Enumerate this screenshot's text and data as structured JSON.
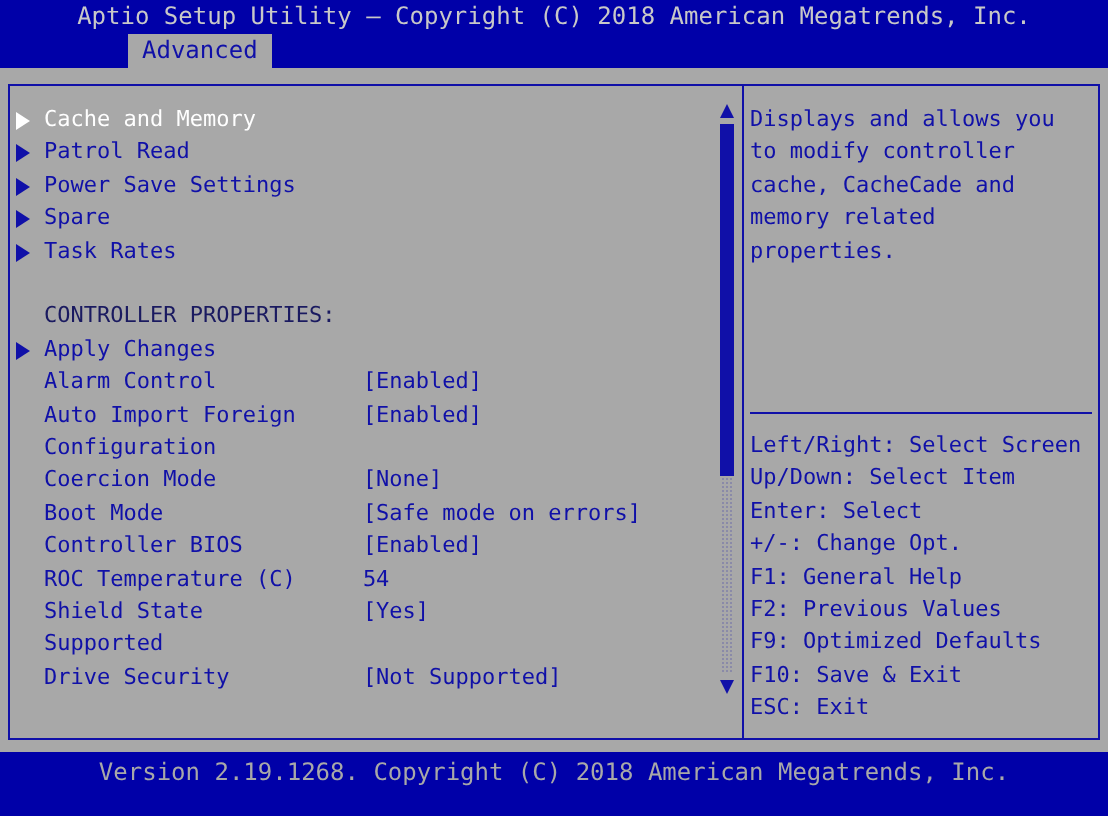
{
  "window": {
    "title": "Aptio Setup Utility – Copyright (C) 2018 American Megatrends, Inc."
  },
  "tabs": [
    {
      "label": "Advanced",
      "selected": true
    }
  ],
  "menu": [
    {
      "kind": "submenu",
      "label": "Cache and Memory",
      "selected": true
    },
    {
      "kind": "submenu",
      "label": "Patrol Read",
      "selected": false
    },
    {
      "kind": "submenu",
      "label": "Power Save Settings",
      "selected": false
    },
    {
      "kind": "submenu",
      "label": "Spare",
      "selected": false
    },
    {
      "kind": "submenu",
      "label": "Task Rates",
      "selected": false
    },
    {
      "kind": "heading",
      "label": "CONTROLLER PROPERTIES:"
    },
    {
      "kind": "submenu",
      "label": "Apply Changes",
      "selected": false
    },
    {
      "kind": "setting",
      "label": "Alarm Control",
      "value": "[Enabled]",
      "selected": false
    },
    {
      "kind": "setting",
      "label": "Auto Import Foreign Configuration",
      "value": "[Enabled]",
      "selected": false
    },
    {
      "kind": "setting",
      "label": "Coercion Mode",
      "value": "[None]",
      "selected": false
    },
    {
      "kind": "setting",
      "label": "Boot Mode",
      "value": "[Safe mode on errors]",
      "selected": false
    },
    {
      "kind": "setting",
      "label": "Controller BIOS",
      "value": "[Enabled]",
      "selected": false
    },
    {
      "kind": "setting",
      "label": "ROC Temperature (C)",
      "value": "54",
      "selected": false
    },
    {
      "kind": "setting",
      "label": "Shield State Supported",
      "value": "[Yes]",
      "selected": false
    },
    {
      "kind": "setting",
      "label": "Drive Security",
      "value": "[Not Supported]",
      "selected": false
    }
  ],
  "help": "Displays and allows you to modify controller cache, CacheCade and memory related properties.",
  "keys": [
    "Left/Right: Select Screen",
    "Up/Down: Select Item",
    "Enter: Select",
    "+/-: Change Opt.",
    "F1: General Help",
    "F2: Previous Values",
    "F9: Optimized Defaults",
    "F10: Save & Exit",
    "ESC: Exit"
  ],
  "footer": "Version 2.19.1268. Copyright (C) 2018 American Megatrends, Inc."
}
